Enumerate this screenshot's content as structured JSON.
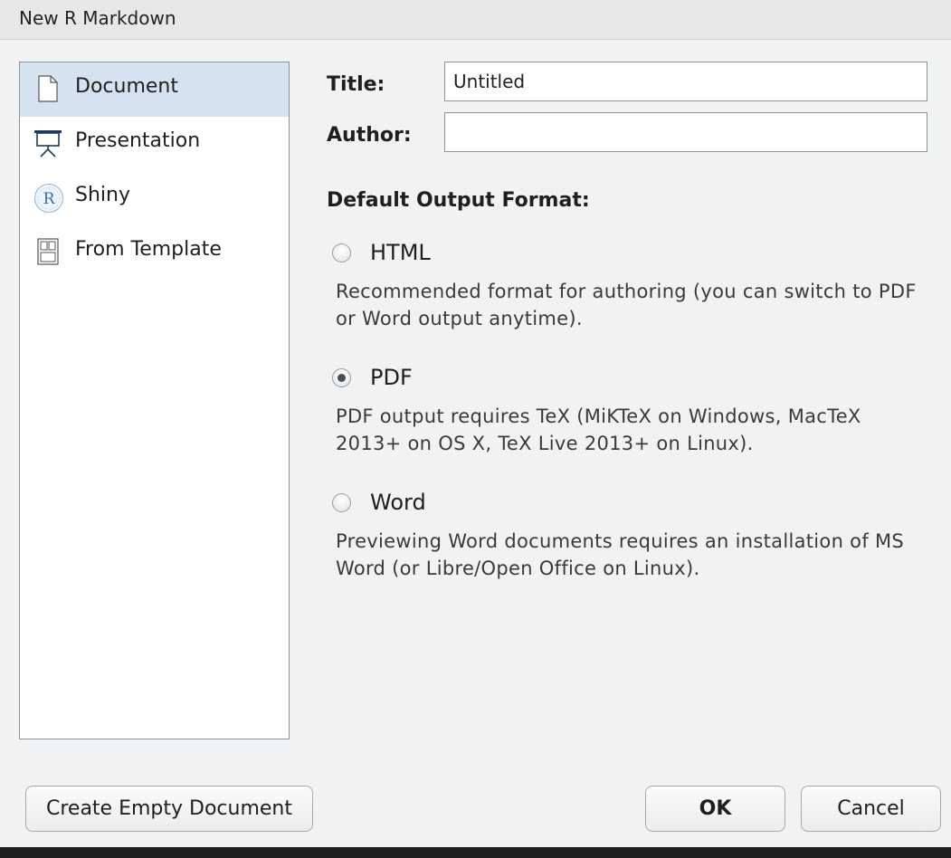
{
  "window": {
    "title": "New R Markdown"
  },
  "sidebar": {
    "items": [
      {
        "label": "Document",
        "icon": "document-icon",
        "selected": true
      },
      {
        "label": "Presentation",
        "icon": "presentation-icon",
        "selected": false
      },
      {
        "label": "Shiny",
        "icon": "shiny-r-icon",
        "selected": false
      },
      {
        "label": "From Template",
        "icon": "template-icon",
        "selected": false
      }
    ]
  },
  "form": {
    "title_label": "Title:",
    "title_value": "Untitled",
    "author_label": "Author:",
    "author_value": ""
  },
  "output": {
    "heading": "Default Output Format:",
    "options": [
      {
        "label": "HTML",
        "checked": false,
        "description": "Recommended format for authoring (you can switch to PDF or Word output anytime)."
      },
      {
        "label": "PDF",
        "checked": true,
        "description": "PDF output requires TeX (MiKTeX on Windows, MacTeX 2013+ on OS X, TeX Live 2013+ on Linux)."
      },
      {
        "label": "Word",
        "checked": false,
        "description": "Previewing Word documents requires an installation of MS Word (or Libre/Open Office on Linux)."
      }
    ]
  },
  "buttons": {
    "create_empty": "Create Empty Document",
    "ok": "OK",
    "cancel": "Cancel"
  },
  "colors": {
    "selected_item_bg": "#d5e3f0",
    "dialog_bg": "#f1f2f3"
  }
}
